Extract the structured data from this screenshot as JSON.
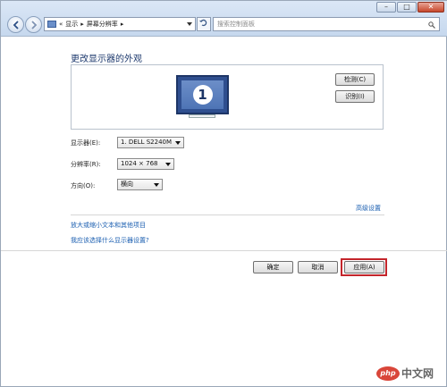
{
  "window": {
    "caption_buttons": {
      "minimize": "–",
      "maximize": "□",
      "close": "✕"
    }
  },
  "address_bar": {
    "prefix": "«",
    "crumbs": [
      "显示",
      "屏幕分辨率"
    ],
    "separator": "▸",
    "search_placeholder": "搜索控制面板"
  },
  "main": {
    "title": "更改显示器的外观",
    "monitor_number": "1",
    "detect_button": "检测(C)",
    "identify_button": "识别(I)",
    "display_label": "显示器(E):",
    "display_value": "1. DELL S2240M",
    "resolution_label": "分辨率(R):",
    "resolution_value": "1024 × 768",
    "orientation_label": "方向(O):",
    "orientation_value": "横向",
    "advanced_link": "高级设置",
    "link_text_size": "放大或缩小文本和其他项目",
    "link_which_settings": "我应该选择什么显示器设置?"
  },
  "footer": {
    "ok_button": "确定",
    "cancel_button": "取消",
    "apply_button": "应用(A)"
  },
  "watermark": {
    "logo": "php",
    "text": "中文网"
  },
  "colors": {
    "accent": "#1a5eb0",
    "highlight": "#c4252b",
    "monitor": "#2f4f8f"
  }
}
